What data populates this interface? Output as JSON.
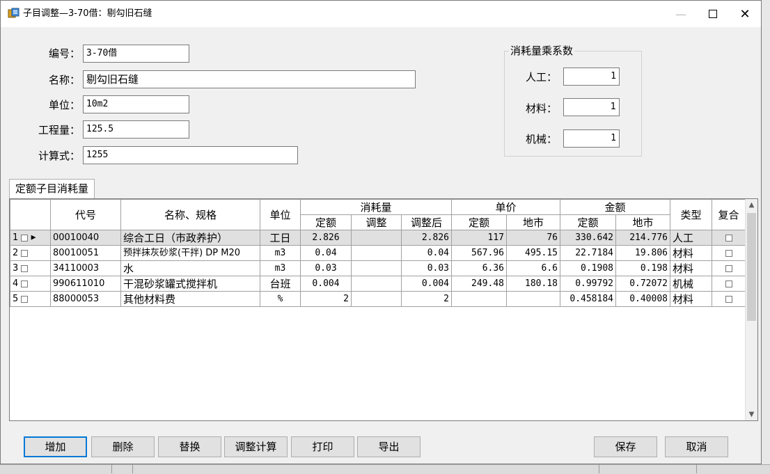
{
  "window": {
    "title": "子目调整—3-70借：剔勾旧石缝",
    "minimize_icon": "minimize-icon",
    "maximize_icon": "maximize-icon",
    "close_icon": "close-icon"
  },
  "form": {
    "code_label": "编号：",
    "code_value": "3-70借",
    "name_label": "名称：",
    "name_value": "剔勾旧石缝",
    "unit_label": "单位：",
    "unit_value": "10m2",
    "quantity_label": "工程量：",
    "quantity_value": "125.5",
    "formula_label": "计算式：",
    "formula_value": "1255"
  },
  "coefficients": {
    "title": "消耗量乘系数",
    "labor_label": "人工：",
    "labor_value": "1",
    "material_label": "材料：",
    "material_value": "1",
    "machine_label": "机械：",
    "machine_value": "1"
  },
  "tab_label": "定额子目消耗量",
  "table": {
    "headers": {
      "code": "代号",
      "name": "名称、规格",
      "unit": "单位",
      "consumption": "消耗量",
      "cons_quota": "定额",
      "cons_adjust": "调整",
      "cons_adjusted": "调整后",
      "price": "单价",
      "price_quota": "定额",
      "price_local": "地市",
      "amount": "金额",
      "amount_quota": "定额",
      "amount_local": "地市",
      "type": "类型",
      "composite": "复合"
    },
    "rows": [
      {
        "no": "1",
        "code": "00010040",
        "name": "综合工日（市政养护）",
        "unit": "工日",
        "cons_quota": "2.826",
        "cons_adjust": "",
        "cons_adjusted": "2.826",
        "price_quota": "117",
        "price_local": "76",
        "amount_quota": "330.642",
        "amount_local": "214.776",
        "type": "人工"
      },
      {
        "no": "2",
        "code": "80010051",
        "name": "预拌抹灰砂浆(干拌) DP M20",
        "unit": "m3",
        "cons_quota": "0.04",
        "cons_adjust": "",
        "cons_adjusted": "0.04",
        "price_quota": "567.96",
        "price_local": "495.15",
        "amount_quota": "22.7184",
        "amount_local": "19.806",
        "type": "材料"
      },
      {
        "no": "3",
        "code": "34110003",
        "name": "水",
        "unit": "m3",
        "cons_quota": "0.03",
        "cons_adjust": "",
        "cons_adjusted": "0.03",
        "price_quota": "6.36",
        "price_local": "6.6",
        "amount_quota": "0.1908",
        "amount_local": "0.198",
        "type": "材料"
      },
      {
        "no": "4",
        "code": "990611010",
        "name": "干混砂浆罐式搅拌机",
        "unit": "台班",
        "cons_quota": "0.004",
        "cons_adjust": "",
        "cons_adjusted": "0.004",
        "price_quota": "249.48",
        "price_local": "180.18",
        "amount_quota": "0.99792",
        "amount_local": "0.72072",
        "type": "机械"
      },
      {
        "no": "5",
        "code": "88000053",
        "name": "其他材料费",
        "unit": "%",
        "cons_quota": "2",
        "cons_adjust": "",
        "cons_adjusted": "2",
        "price_quota": "",
        "price_local": "",
        "amount_quota": "0.458184",
        "amount_local": "0.40008",
        "type": "材料"
      }
    ]
  },
  "buttons": {
    "add": "增加",
    "delete": "删除",
    "replace": "替换",
    "adjust_calc": "调整计算",
    "print": "打印",
    "export": "导出",
    "save": "保存",
    "cancel": "取消"
  }
}
